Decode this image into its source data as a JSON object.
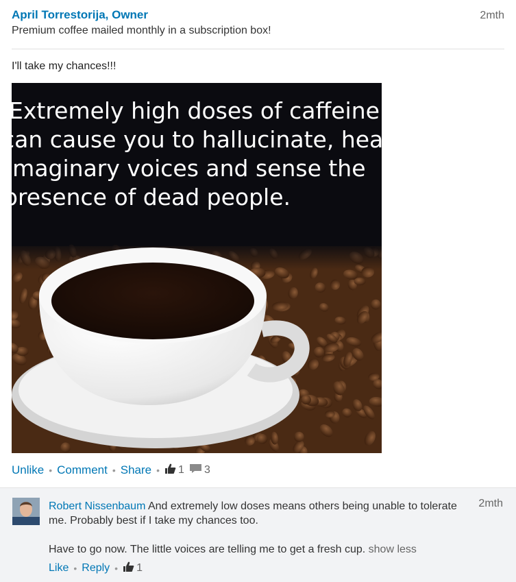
{
  "post": {
    "author": "April Torrestorija, Owner",
    "headline": "Premium coffee mailed monthly in a subscription box!",
    "time": "2mth",
    "text": "I'll take my chances!!!",
    "image_text": [
      "Extremely high doses of caffeine",
      "can cause you to hallucinate, hear",
      "imaginary voices and sense the",
      "presence of dead people."
    ]
  },
  "actions": {
    "unlike": "Unlike",
    "comment": "Comment",
    "share": "Share",
    "like_count": "1",
    "comment_count": "3"
  },
  "comment": {
    "name": "Robert Nissenbaum",
    "text1": "And extremely low doses means others being unable to tolerate me. Probably best if I take my chances too.",
    "text2": "Have to go now. The little voices are telling me to get a fresh cup.",
    "show_less": "show less",
    "time": "2mth",
    "like": "Like",
    "reply": "Reply",
    "like_count": "1"
  },
  "colors": {
    "link": "#0077b5",
    "comment_bg": "#f2f3f5"
  }
}
